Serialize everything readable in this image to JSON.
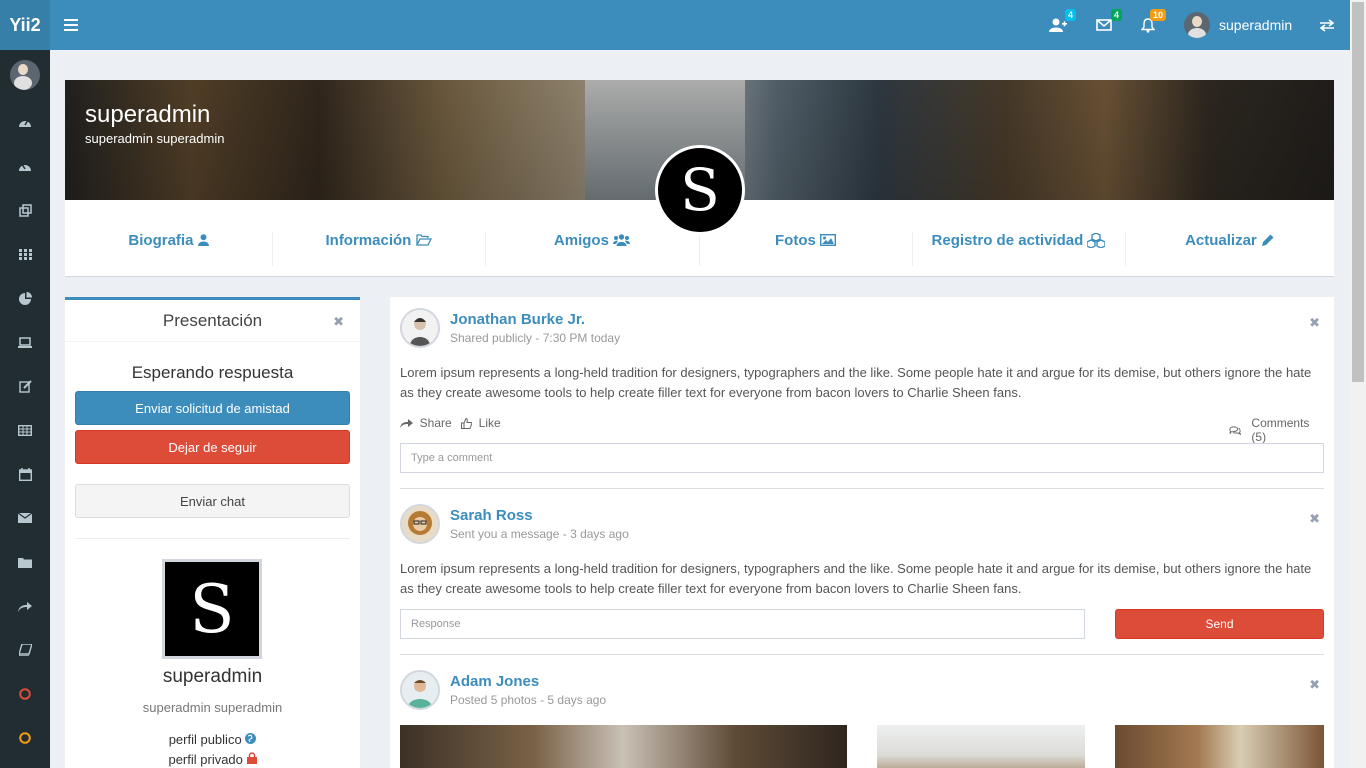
{
  "app": {
    "logo": "Yii2"
  },
  "header": {
    "badges": {
      "friends": "4",
      "messages": "4",
      "notifications": "10"
    },
    "username": "superadmin"
  },
  "banner": {
    "title": "superadmin",
    "subtitle": "superadmin superadmin",
    "logo_letter": "S"
  },
  "profile_nav": [
    {
      "label": "Biografia"
    },
    {
      "label": "Información"
    },
    {
      "label": "Amigos"
    },
    {
      "label": "Fotos"
    },
    {
      "label": "Registro de actividad"
    },
    {
      "label": "Actualizar"
    }
  ],
  "presentation": {
    "title": "Presentación",
    "status": "Esperando respuesta",
    "btn_friend": "Enviar solicitud de amistad",
    "btn_unfollow": "Dejar de seguir",
    "btn_chat": "Enviar chat",
    "logo_letter": "S",
    "username": "superadmin",
    "fullname": "superadmin superadmin",
    "public": "perfil publico",
    "private": "perfil privado"
  },
  "feed": {
    "posts": [
      {
        "name": "Jonathan Burke Jr.",
        "meta": "Shared publicly - 7:30 PM today",
        "text": "Lorem ipsum represents a long-held tradition for designers, typographers and the like. Some people hate it and argue for its demise, but others ignore the hate as they create awesome tools to help create filler text for everyone from bacon lovers to Charlie Sheen fans.",
        "share": "Share",
        "like": "Like",
        "comments": "Comments (5)",
        "comment_placeholder": "Type a comment"
      },
      {
        "name": "Sarah Ross",
        "meta": "Sent you a message - 3 days ago",
        "text": "Lorem ipsum represents a long-held tradition for designers, typographers and the like. Some people hate it and argue for its demise, but others ignore the hate as they create awesome tools to help create filler text for everyone from bacon lovers to Charlie Sheen fans.",
        "response_placeholder": "Response",
        "send": "Send"
      },
      {
        "name": "Adam Jones",
        "meta": "Posted 5 photos - 5 days ago"
      }
    ]
  },
  "colors": {
    "primary": "#3c8dbc",
    "danger": "#dd4b39",
    "sidebar": "#222d32"
  }
}
